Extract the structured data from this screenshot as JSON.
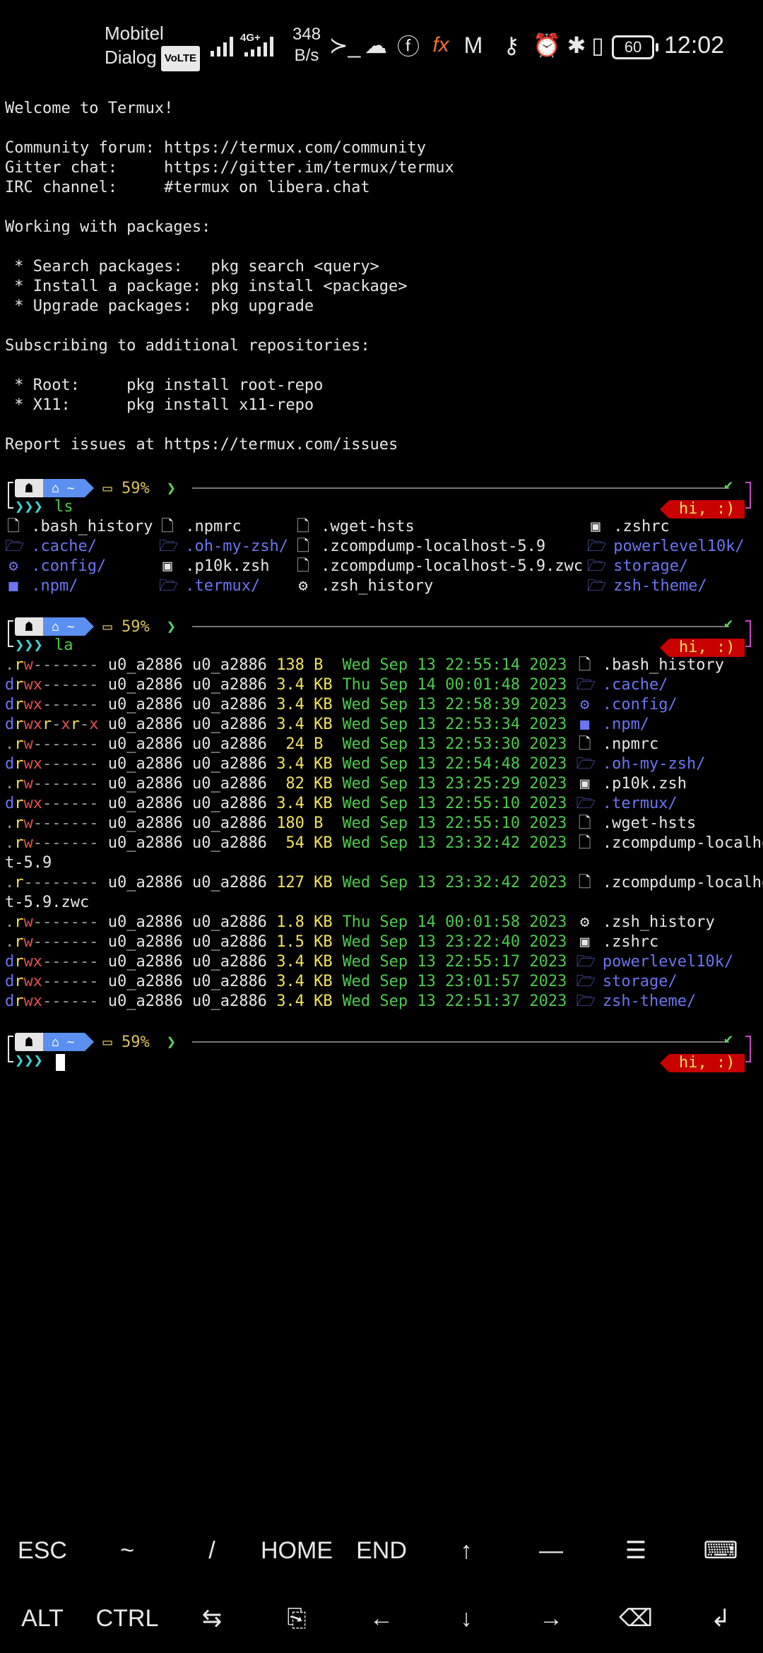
{
  "status": {
    "carrier1": "Mobitel",
    "carrier2": "Dialog",
    "volte": "VoLTE",
    "net_type": "4G+",
    "speed_value": "348",
    "speed_unit": "B/s",
    "battery": "60",
    "time": "12:02",
    "icons": [
      "terminal-icon",
      "cloud-icon",
      "facebook-icon",
      "fx-icon",
      "gmail-icon",
      "key-icon",
      "alarm-icon",
      "bluetooth-icon",
      "battery-saver-icon"
    ]
  },
  "motd": [
    "Welcome to Termux!",
    "",
    "Community forum: https://termux.com/community",
    "Gitter chat:     https://gitter.im/termux/termux",
    "IRC channel:     #termux on libera.chat",
    "",
    "Working with packages:",
    "",
    " * Search packages:   pkg search <query>",
    " * Install a package: pkg install <package>",
    " * Upgrade packages:  pkg upgrade",
    "",
    "Subscribing to additional repositories:",
    "",
    " * Root:     pkg install root-repo",
    " * X11:      pkg install x11-repo",
    "",
    "Report issues at https://termux.com/issues"
  ],
  "prompt": {
    "home": "~",
    "battery": "59%",
    "caret": "❯❯❯",
    "check": "✔",
    "greeting": "hi, :)"
  },
  "commands": [
    "ls",
    "la"
  ],
  "ls_output": [
    {
      "icon": "file",
      "name": ".bash_history",
      "color": "white",
      "col": 0,
      "row": 0
    },
    {
      "icon": "file",
      "name": ".npmrc",
      "color": "white",
      "col": 1,
      "row": 0
    },
    {
      "icon": "file",
      "name": ".wget-hsts",
      "color": "white",
      "col": 2,
      "row": 0
    },
    {
      "icon": "term",
      "name": ".zshrc",
      "color": "white",
      "col": 3,
      "row": 0
    },
    {
      "icon": "folder",
      "name": ".cache/",
      "color": "blue",
      "col": 0,
      "row": 1
    },
    {
      "icon": "folder",
      "name": ".oh-my-zsh/",
      "color": "blue",
      "col": 1,
      "row": 1
    },
    {
      "icon": "file",
      "name": ".zcompdump-localhost-5.9",
      "color": "white",
      "col": 2,
      "row": 1
    },
    {
      "icon": "folder",
      "name": "powerlevel10k/",
      "color": "blue",
      "col": 3,
      "row": 1
    },
    {
      "icon": "gear-folder",
      "name": ".config/",
      "color": "blue",
      "col": 0,
      "row": 2
    },
    {
      "icon": "term",
      "name": ".p10k.zsh",
      "color": "white",
      "col": 1,
      "row": 2
    },
    {
      "icon": "file",
      "name": ".zcompdump-localhost-5.9.zwc",
      "color": "white",
      "col": 2,
      "row": 2
    },
    {
      "icon": "folder",
      "name": "storage/",
      "color": "blue",
      "col": 3,
      "row": 2
    },
    {
      "icon": "npm-folder",
      "name": ".npm/",
      "color": "blue",
      "col": 0,
      "row": 3
    },
    {
      "icon": "folder",
      "name": ".termux/",
      "color": "blue",
      "col": 1,
      "row": 3
    },
    {
      "icon": "gear",
      "name": ".zsh_history",
      "color": "white",
      "col": 2,
      "row": 3
    },
    {
      "icon": "folder",
      "name": "zsh-theme/",
      "color": "blue",
      "col": 3,
      "row": 3
    }
  ],
  "la_output": [
    {
      "perm": ".rw-------",
      "user": "u0_a2886",
      "group": "u0_a2886",
      "size": "138 B",
      "date": "Wed Sep 13 22:55:14 2023",
      "icon": "file",
      "name": ".bash_history",
      "color": "white"
    },
    {
      "perm": "drwx------",
      "user": "u0_a2886",
      "group": "u0_a2886",
      "size": "3.4 KB",
      "date": "Thu Sep 14 00:01:48 2023",
      "icon": "folder",
      "name": ".cache/",
      "color": "blue"
    },
    {
      "perm": "drwx------",
      "user": "u0_a2886",
      "group": "u0_a2886",
      "size": "3.4 KB",
      "date": "Wed Sep 13 22:58:39 2023",
      "icon": "gear-folder",
      "name": ".config/",
      "color": "blue"
    },
    {
      "perm": "drwxr-xr-x",
      "user": "u0_a2886",
      "group": "u0_a2886",
      "size": "3.4 KB",
      "date": "Wed Sep 13 22:53:34 2023",
      "icon": "npm-folder",
      "name": ".npm/",
      "color": "blue"
    },
    {
      "perm": ".rw-------",
      "user": "u0_a2886",
      "group": "u0_a2886",
      "size": " 24 B",
      "date": "Wed Sep 13 22:53:30 2023",
      "icon": "file",
      "name": ".npmrc",
      "color": "white"
    },
    {
      "perm": "drwx------",
      "user": "u0_a2886",
      "group": "u0_a2886",
      "size": "3.4 KB",
      "date": "Wed Sep 13 22:54:48 2023",
      "icon": "folder",
      "name": ".oh-my-zsh/",
      "color": "blue"
    },
    {
      "perm": ".rw-------",
      "user": "u0_a2886",
      "group": "u0_a2886",
      "size": " 82 KB",
      "date": "Wed Sep 13 23:25:29 2023",
      "icon": "term",
      "name": ".p10k.zsh",
      "color": "white"
    },
    {
      "perm": "drwx------",
      "user": "u0_a2886",
      "group": "u0_a2886",
      "size": "3.4 KB",
      "date": "Wed Sep 13 22:55:10 2023",
      "icon": "folder",
      "name": ".termux/",
      "color": "blue"
    },
    {
      "perm": ".rw-------",
      "user": "u0_a2886",
      "group": "u0_a2886",
      "size": "180 B",
      "date": "Wed Sep 13 22:55:10 2023",
      "icon": "file",
      "name": ".wget-hsts",
      "color": "white"
    },
    {
      "perm": ".rw-------",
      "user": "u0_a2886",
      "group": "u0_a2886",
      "size": " 54 KB",
      "date": "Wed Sep 13 23:32:42 2023",
      "icon": "file",
      "name": ".zcompdump-localhos",
      "cont": "t-5.9",
      "color": "white"
    },
    {
      "perm": ".r--------",
      "user": "u0_a2886",
      "group": "u0_a2886",
      "size": "127 KB",
      "date": "Wed Sep 13 23:32:42 2023",
      "icon": "file",
      "name": ".zcompdump-localhos",
      "cont": "t-5.9.zwc",
      "color": "white"
    },
    {
      "perm": ".rw-------",
      "user": "u0_a2886",
      "group": "u0_a2886",
      "size": "1.8 KB",
      "date": "Thu Sep 14 00:01:58 2023",
      "icon": "gear",
      "name": ".zsh_history",
      "color": "white"
    },
    {
      "perm": ".rw-------",
      "user": "u0_a2886",
      "group": "u0_a2886",
      "size": "1.5 KB",
      "date": "Wed Sep 13 23:22:40 2023",
      "icon": "term",
      "name": ".zshrc",
      "color": "white"
    },
    {
      "perm": "drwx------",
      "user": "u0_a2886",
      "group": "u0_a2886",
      "size": "3.4 KB",
      "date": "Wed Sep 13 22:55:17 2023",
      "icon": "folder",
      "name": "powerlevel10k/",
      "color": "blue"
    },
    {
      "perm": "drwx------",
      "user": "u0_a2886",
      "group": "u0_a2886",
      "size": "3.4 KB",
      "date": "Wed Sep 13 23:01:57 2023",
      "icon": "folder",
      "name": "storage/",
      "color": "blue"
    },
    {
      "perm": "drwx------",
      "user": "u0_a2886",
      "group": "u0_a2886",
      "size": "3.4 KB",
      "date": "Wed Sep 13 22:51:37 2023",
      "icon": "folder",
      "name": "zsh-theme/",
      "color": "blue"
    }
  ],
  "extra_keys": {
    "row1": [
      "ESC",
      "~",
      "/",
      "HOME",
      "END",
      "↑",
      "—",
      "☰",
      "⌨"
    ],
    "row2": [
      "ALT",
      "CTRL",
      "⇆",
      "⎘",
      "←",
      "↓",
      "→",
      "⌫",
      "↲"
    ]
  },
  "colors": {
    "background": "#000000",
    "prompt_home": "#5b8ff0",
    "greeting_bg": "#c80000",
    "dir_blue": "#6b75f0",
    "date_green": "#4ec94e"
  }
}
